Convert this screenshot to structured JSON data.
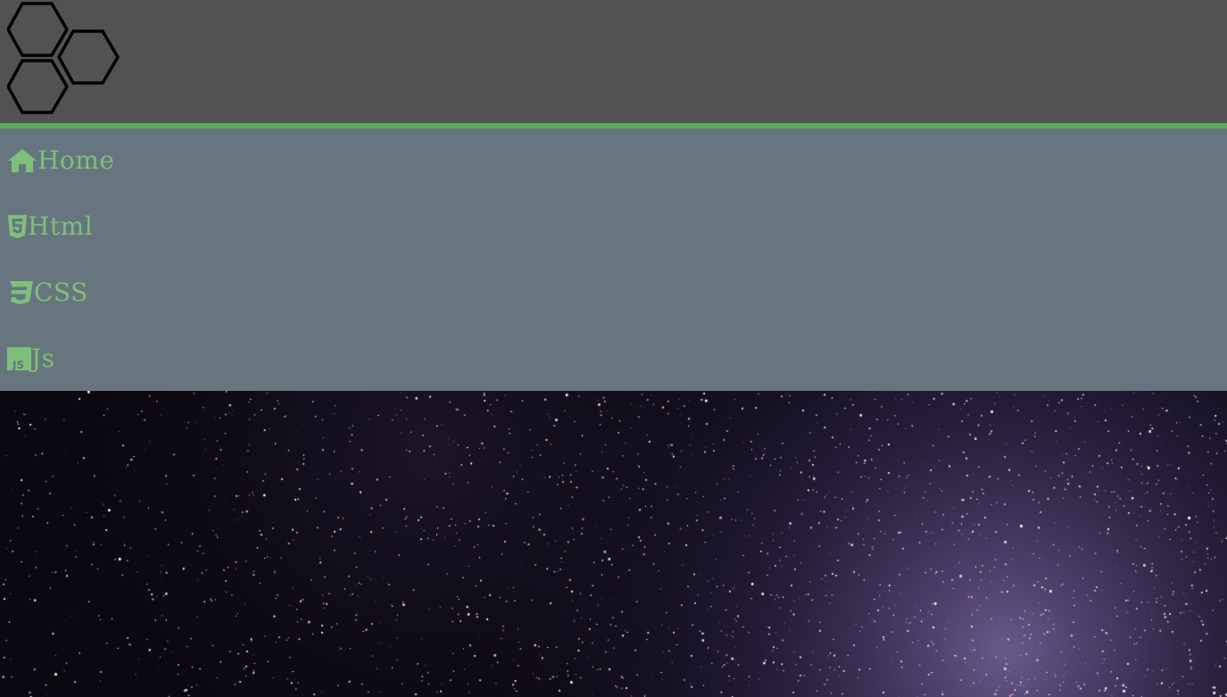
{
  "colors": {
    "header_bg": "#525252",
    "accent": "#5dab5b",
    "nav_bg": "#67767e",
    "nav_text": "#7fbf7b",
    "sky_dark": "#0a0810",
    "milky_way": "#8e7ab6"
  },
  "logo": {
    "icon": "honeycomb-hexagon-logo"
  },
  "nav": {
    "items": [
      {
        "label": "Home",
        "icon": "home-icon"
      },
      {
        "label": "Html",
        "icon": "html5-icon"
      },
      {
        "label": "CSS",
        "icon": "css3-icon"
      },
      {
        "label": "Js",
        "icon": "js-icon"
      }
    ]
  },
  "hero": {
    "image": "starry-night-sky-milky-way"
  }
}
